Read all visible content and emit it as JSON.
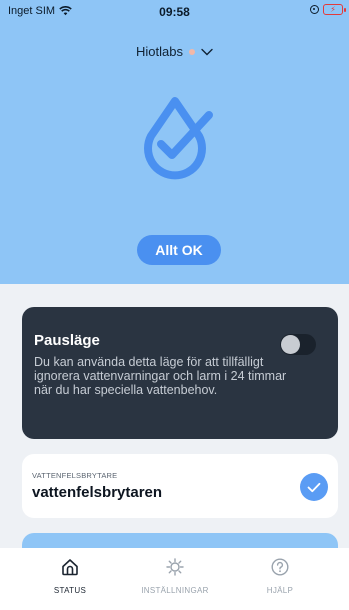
{
  "status_bar": {
    "carrier": "Inget SIM",
    "time": "09:58"
  },
  "header": {
    "device_name": "Hiotlabs"
  },
  "status": {
    "label": "Allt OK"
  },
  "pause_mode": {
    "title": "Pausläge",
    "description": "Du kan använda detta läge för att tillfälligt ignorera vattenvarningar och larm i 24 timmar när du har speciella vattenbehov.",
    "enabled": false
  },
  "valve": {
    "kicker": "VATTENFELSBRYTARE",
    "name": "vattenfelsbrytaren"
  },
  "tabs": [
    {
      "label": "STATUS",
      "icon": "home-icon",
      "active": true
    },
    {
      "label": "INSTÄLLNINGAR",
      "icon": "gear-icon",
      "active": false
    },
    {
      "label": "HJÄLP",
      "icon": "help-icon",
      "active": false
    }
  ],
  "colors": {
    "hero": "#8ec5f6",
    "accent": "#4a90f0",
    "dark_card": "#2a3441"
  }
}
